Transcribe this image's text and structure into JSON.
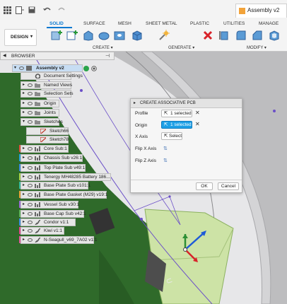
{
  "window": {
    "tab_title": "Assembly v2"
  },
  "ribbon": {
    "tabs": [
      "SOLID",
      "SURFACE",
      "MESH",
      "SHEET METAL",
      "PLASTIC",
      "UTILITIES",
      "MANAGE"
    ],
    "workspace_button": "DESIGN",
    "groups": [
      "CREATE",
      "GENERATE",
      "MODIFY"
    ]
  },
  "browser": {
    "title": "BROWSER",
    "root": "Assembly v2",
    "items": [
      {
        "label": "Document Settings",
        "icon": "gear-icon"
      },
      {
        "label": "Named Views",
        "icon": "folder-icon"
      },
      {
        "label": "Selection Sets",
        "icon": "folder-icon"
      },
      {
        "label": "Origin",
        "icon": "folder-icon"
      },
      {
        "label": "Joints",
        "icon": "folder-icon"
      },
      {
        "label": "Sketches",
        "icon": "folder-icon"
      },
      {
        "label": "Sketch66",
        "icon": "sketch-icon"
      },
      {
        "label": "Sketch78",
        "icon": "sketch-icon"
      },
      {
        "label": "Core Sub:1",
        "icon": "component-icon"
      },
      {
        "label": "Chassis Sub v26:1",
        "icon": "component-icon"
      },
      {
        "label": "Top Plate Sub v49:1",
        "icon": "component-icon"
      },
      {
        "label": "Tenergy MH48285 Battery 186...",
        "icon": "component-icon"
      },
      {
        "label": "Base Plate Sub v101:1",
        "icon": "component-icon"
      },
      {
        "label": "Base Plate Gasket (M29) v19:1",
        "icon": "component-icon"
      },
      {
        "label": "Vessel Sub v30:1",
        "icon": "component-icon"
      },
      {
        "label": "Base Cap Sub v42:1",
        "icon": "component-icon"
      },
      {
        "label": "Condor v1:1",
        "icon": "link-icon"
      },
      {
        "label": "Kiwi v1:1",
        "icon": "link-icon"
      },
      {
        "label": "N-Seagull_v69_7A02 v1:1",
        "icon": "link-icon"
      }
    ]
  },
  "dialog": {
    "title": "CREATE ASSOCIATIVE PCB",
    "profile_label": "Profile",
    "profile_value": "1 selected",
    "origin_label": "Origin",
    "origin_value": "1 selected",
    "xaxis_label": "X Axis",
    "xaxis_value": "Select",
    "flipx_label": "Flip X Axis",
    "flipz_label": "Flip Z Axis",
    "ok": "OK",
    "cancel": "Cancel"
  },
  "colors": {
    "accent": "#0a79d0",
    "origin_active": "#1ea0e6",
    "pcb_green": "#2f6a2a",
    "pcb_light": "#cde3a6"
  }
}
